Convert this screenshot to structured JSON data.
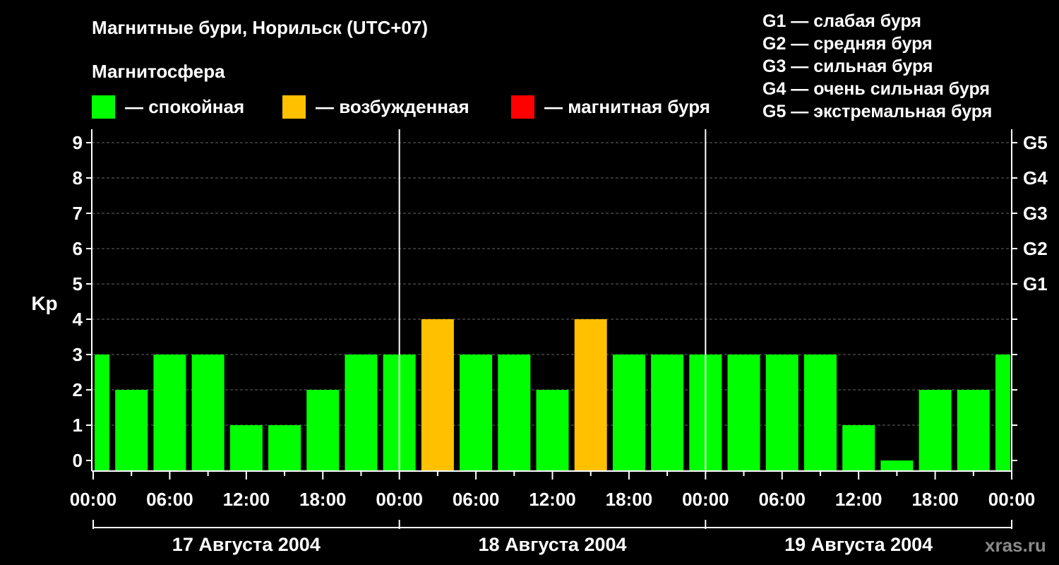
{
  "chart_data": {
    "type": "bar",
    "title": "Магнитные бури, Норильск (UTC+07)",
    "ylabel": "Kp",
    "ylim": [
      0,
      9
    ],
    "yticks": [
      "0",
      "1",
      "2",
      "3",
      "4",
      "5",
      "6",
      "7",
      "8",
      "9"
    ],
    "right_ticks": [
      {
        "value": 5,
        "label": "G1"
      },
      {
        "value": 6,
        "label": "G2"
      },
      {
        "value": 7,
        "label": "G3"
      },
      {
        "value": 8,
        "label": "G4"
      },
      {
        "value": 9,
        "label": "G5"
      }
    ],
    "x_tick_labels": [
      "00:00",
      "06:00",
      "12:00",
      "18:00",
      "00:00",
      "06:00",
      "12:00",
      "18:00",
      "00:00",
      "06:00",
      "12:00",
      "18:00",
      "00:00"
    ],
    "days": [
      "17 Августа 2004",
      "18 Августа 2004",
      "19 Августа 2004"
    ],
    "interval_hours": 3,
    "values": [
      3,
      2,
      3,
      3,
      1,
      1,
      2,
      3,
      3,
      4,
      3,
      3,
      2,
      4,
      3,
      3,
      3,
      3,
      3,
      3,
      1,
      0,
      2,
      2,
      3
    ],
    "grid": "dashed horizontal",
    "colors": {
      "calm": "#00ff00",
      "active": "#ffc000",
      "storm": "#ff0000",
      "background": "#000000",
      "grid": "#666666"
    }
  },
  "magnetosphere": {
    "title": "Магнитосфера",
    "legend": [
      {
        "label": "— спокойная",
        "color": "#00ff00"
      },
      {
        "label": "— возбужденная",
        "color": "#ffc000"
      },
      {
        "label": "— магнитная буря",
        "color": "#ff0000"
      }
    ]
  },
  "g_scale": [
    "G1 — слабая буря",
    "G2 — средняя буря",
    "G3 — сильная буря",
    "G4 — очень сильная буря",
    "G5 — экстремальная буря"
  ],
  "brand": "xras.ru"
}
